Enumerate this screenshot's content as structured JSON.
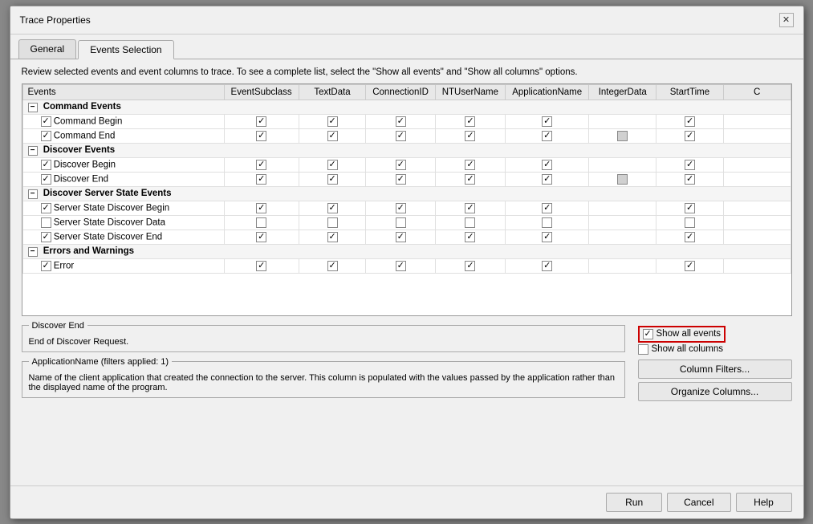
{
  "dialog": {
    "title": "Trace Properties",
    "close_label": "✕"
  },
  "tabs": [
    {
      "id": "general",
      "label": "General",
      "active": false
    },
    {
      "id": "events-selection",
      "label": "Events Selection",
      "active": true
    }
  ],
  "instructions": "Review selected events and event columns to trace. To see a complete list, select the \"Show all events\" and \"Show all columns\" options.",
  "table": {
    "columns": [
      "Events",
      "EventSubclass",
      "TextData",
      "ConnectionID",
      "NTUserName",
      "ApplicationName",
      "IntegerData",
      "StartTime",
      "C"
    ],
    "groups": [
      {
        "name": "Command Events",
        "collapsed": false,
        "rows": [
          {
            "name": "Command Begin",
            "cols": [
              true,
              true,
              true,
              true,
              true,
              false,
              true
            ]
          },
          {
            "name": "Command End",
            "cols": [
              true,
              true,
              true,
              true,
              true,
              false,
              true
            ]
          }
        ]
      },
      {
        "name": "Discover Events",
        "collapsed": false,
        "rows": [
          {
            "name": "Discover Begin",
            "cols": [
              true,
              true,
              true,
              true,
              true,
              false,
              true
            ]
          },
          {
            "name": "Discover End",
            "cols": [
              true,
              true,
              true,
              true,
              true,
              false,
              true
            ]
          }
        ]
      },
      {
        "name": "Discover Server State Events",
        "collapsed": false,
        "rows": [
          {
            "name": "Server State Discover Begin",
            "cols": [
              true,
              true,
              true,
              true,
              true,
              false,
              true
            ]
          },
          {
            "name": "Server State Discover Data",
            "cols": [
              false,
              false,
              false,
              false,
              false,
              false,
              false
            ]
          },
          {
            "name": "Server State Discover End",
            "cols": [
              true,
              true,
              true,
              true,
              true,
              false,
              true
            ]
          }
        ]
      },
      {
        "name": "Errors and Warnings",
        "collapsed": false,
        "rows": [
          {
            "name": "Error",
            "cols": [
              true,
              true,
              true,
              true,
              true,
              false,
              true
            ]
          }
        ]
      }
    ]
  },
  "discover_end_box": {
    "title": "Discover End",
    "text": "End of Discover Request."
  },
  "show_options": {
    "show_all_events_label": "Show all events",
    "show_all_columns_label": "Show all columns",
    "show_all_events_checked": true,
    "show_all_columns_checked": false
  },
  "app_name_box": {
    "title": "ApplicationName (filters applied: 1)",
    "text": "Name of the client application that created the connection to the server. This column is populated with the values passed by the application rather than the displayed name of the program."
  },
  "buttons": {
    "column_filters": "Column Filters...",
    "organize_columns": "Organize Columns..."
  },
  "footer": {
    "run": "Run",
    "cancel": "Cancel",
    "help": "Help"
  }
}
